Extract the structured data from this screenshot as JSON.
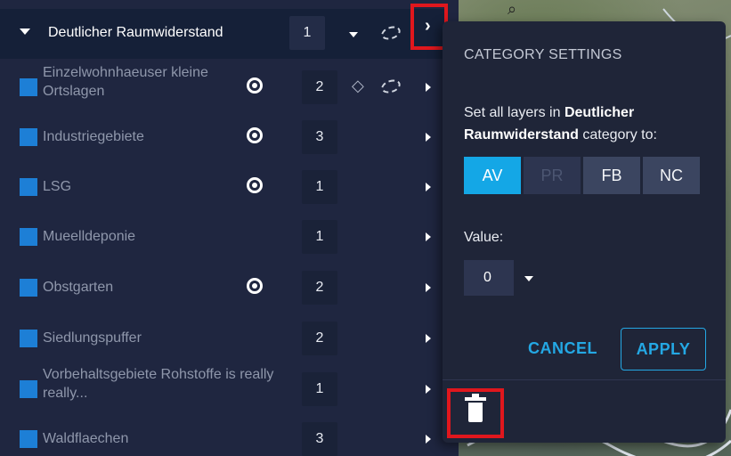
{
  "category": {
    "title": "Deutlicher Raumwiderstand",
    "number": "1"
  },
  "layers": [
    {
      "label": "Einzelwohnhaeuser kleine Ortslagen",
      "number": "2",
      "visible_icon": true
    },
    {
      "label": "Industriegebiete",
      "number": "3",
      "visible_icon": true
    },
    {
      "label": "LSG",
      "number": "1",
      "visible_icon": true
    },
    {
      "label": "Mueelldeponie",
      "number": "1",
      "visible_icon": false
    },
    {
      "label": "Obstgarten",
      "number": "2",
      "visible_icon": true
    },
    {
      "label": "Siedlungspuffer",
      "number": "2",
      "visible_icon": false
    },
    {
      "label": "Vorbehaltsgebiete Rohstoffe is really really...",
      "number": "1",
      "visible_icon": false
    },
    {
      "label": "Waldflaechen",
      "number": "3",
      "visible_icon": false
    }
  ],
  "settings": {
    "title": "CATEGORY SETTINGS",
    "desc_prefix": "Set all layers in ",
    "desc_category": "Deutlicher Raumwiderstand",
    "desc_suffix": " category to:",
    "options": [
      "AV",
      "PR",
      "FB",
      "NC"
    ],
    "selected_option": "AV",
    "disabled_option": "PR",
    "value_label": "Value:",
    "value": "0",
    "cancel_label": "CANCEL",
    "apply_label": "APPLY"
  },
  "colors": {
    "accent": "#14a7e6",
    "swatch": "#1d7fd6",
    "highlight": "#e0171d"
  }
}
